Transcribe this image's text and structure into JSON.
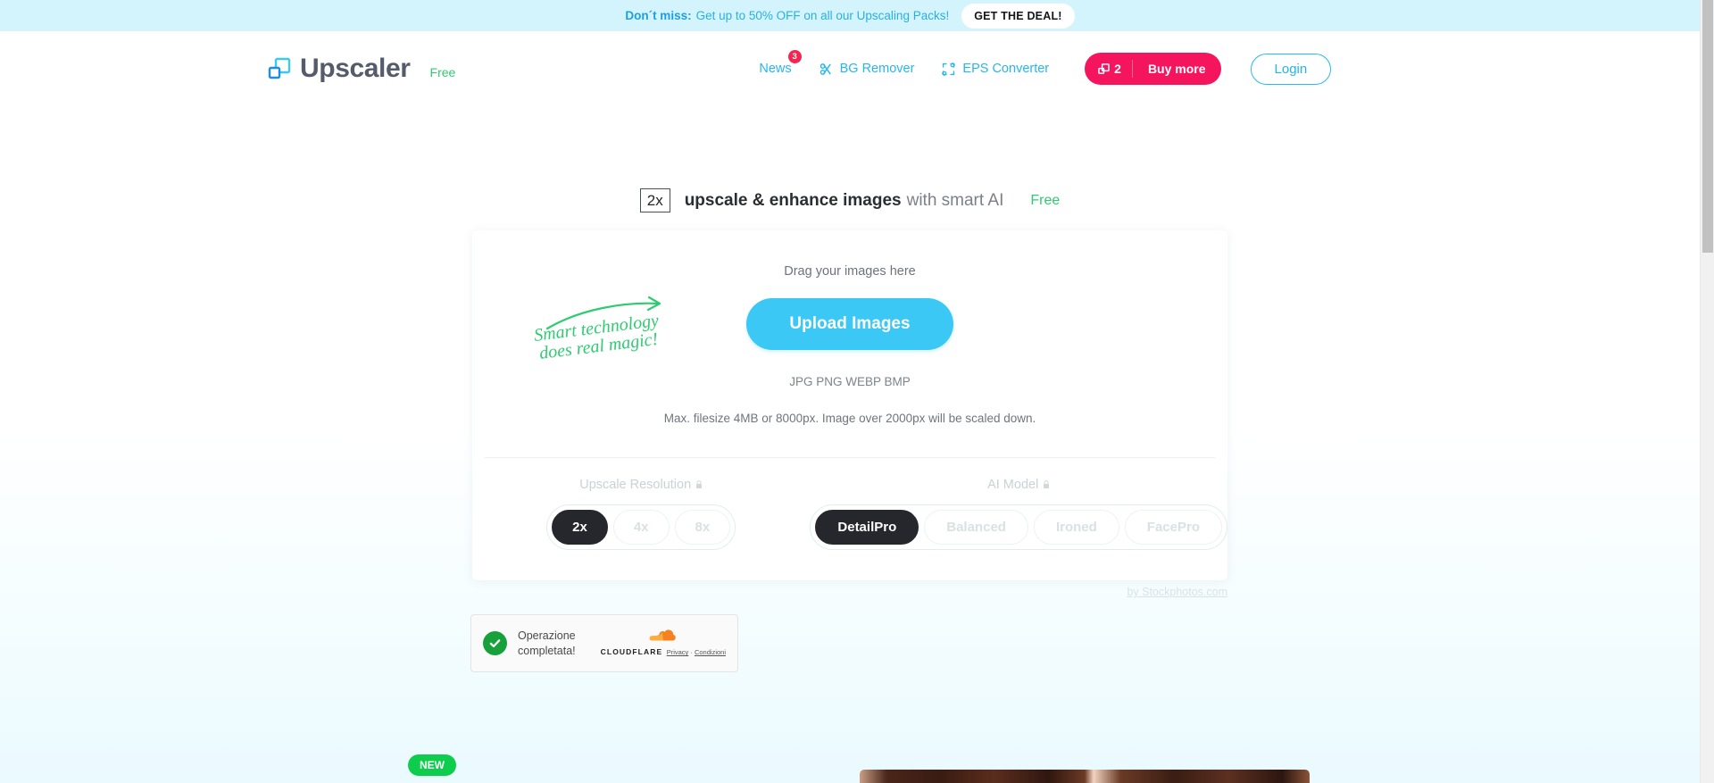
{
  "promo": {
    "strong": "Don´t miss:",
    "text": "Get up to 50% OFF on all our Upscaling Packs!",
    "cta": "GET THE DEAL!"
  },
  "header": {
    "brand_name": "Upscaler",
    "brand_plan": "Free",
    "nav": [
      {
        "label": "News",
        "badge": "3",
        "icon": null
      },
      {
        "label": "BG Remover",
        "badge": null,
        "icon": "bg-remover-icon"
      },
      {
        "label": "EPS Converter",
        "badge": null,
        "icon": "eps-converter-icon"
      }
    ],
    "credits": {
      "count": "2",
      "label": "Buy more"
    },
    "login": "Login"
  },
  "hero": {
    "chip": "2x",
    "bold": "upscale & enhance images",
    "light": "with smart AI",
    "free": "Free"
  },
  "upload": {
    "drag_text": "Drag your images here",
    "button": "Upload Images",
    "magic_line1": "Smart technology",
    "magic_line2": "does real magic!",
    "formats": "JPG PNG WEBP BMP",
    "filesize_note": "Max. filesize 4MB or 8000px. Image over 2000px will be scaled down."
  },
  "options": {
    "resolution": {
      "label": "Upscale Resolution",
      "locked": true,
      "items": [
        {
          "label": "2x",
          "selected": true
        },
        {
          "label": "4x",
          "selected": false
        },
        {
          "label": "8x",
          "selected": false
        }
      ]
    },
    "model": {
      "label": "AI Model",
      "locked": true,
      "items": [
        {
          "label": "DetailPro",
          "selected": true
        },
        {
          "label": "Balanced",
          "selected": false
        },
        {
          "label": "Ironed",
          "selected": false
        },
        {
          "label": "FacePro",
          "selected": false
        }
      ]
    }
  },
  "attribution": "by Stockphotos.com",
  "turnstile": {
    "status": "Operazione completata!",
    "brand": "CLOUDFLARE",
    "privacy": "Privacy",
    "separator": "·",
    "terms": "Condizioni"
  },
  "bottom": {
    "new_badge": "NEW"
  },
  "colors": {
    "banner_bg": "#d4f4fd",
    "accent_cyan": "#26b6f0",
    "accent_pink": "#f5155f",
    "accent_green": "#2ecc71",
    "upload_blue": "#3cc8f5",
    "pill_selected": "#26272d",
    "badge_red": "#f5254f",
    "new_green": "#0ecd4d"
  }
}
